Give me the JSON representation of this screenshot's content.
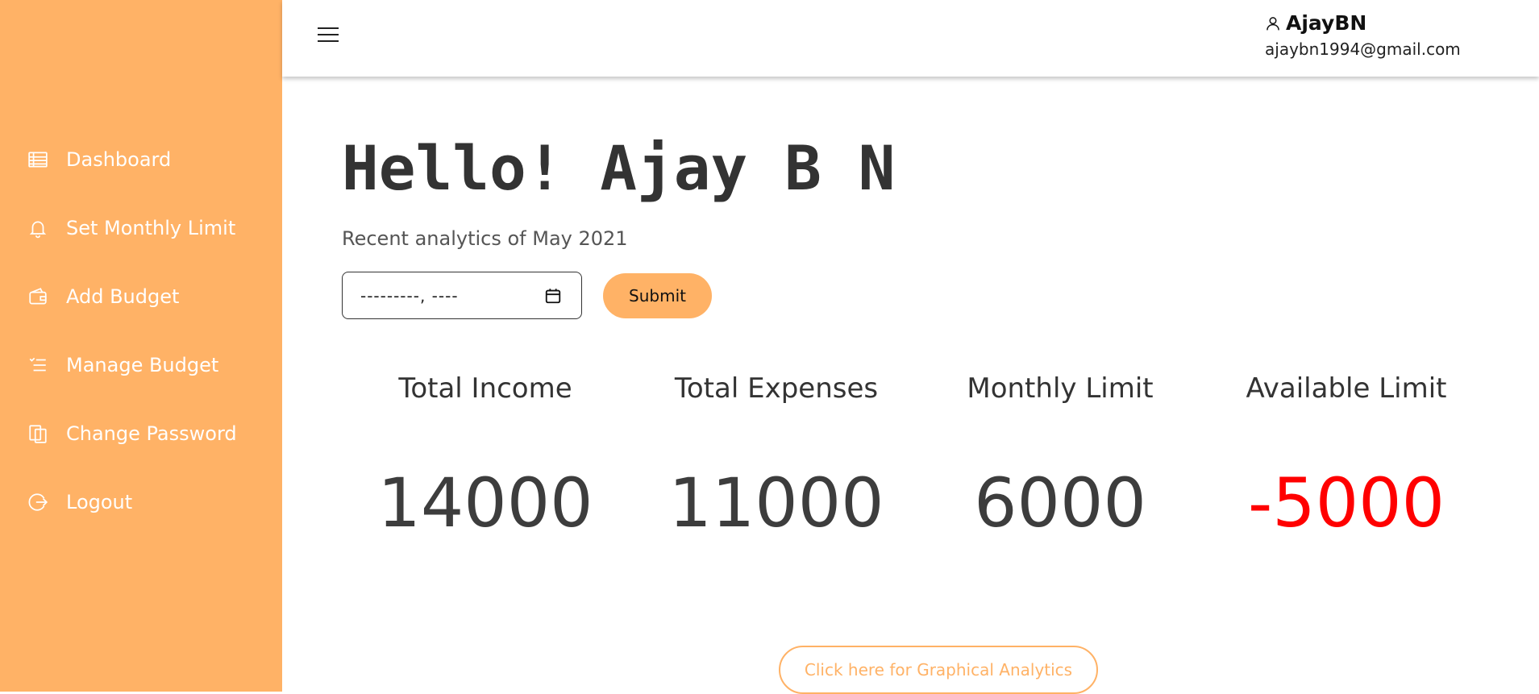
{
  "sidebar": {
    "items": [
      {
        "label": "Dashboard",
        "icon": "dashboard-icon"
      },
      {
        "label": "Set Monthly Limit",
        "icon": "bell-icon"
      },
      {
        "label": "Add Budget",
        "icon": "wallet-icon"
      },
      {
        "label": "Manage Budget",
        "icon": "list-check-icon"
      },
      {
        "label": "Change Password",
        "icon": "copy-icon"
      },
      {
        "label": "Logout",
        "icon": "logout-icon"
      }
    ]
  },
  "header": {
    "user_name": "AjayBN",
    "user_email": "ajaybn1994@gmail.com"
  },
  "main": {
    "greeting": "Hello! Ajay B N",
    "subtitle": "Recent analytics of May 2021",
    "month_input_value": "---------, ----",
    "submit_label": "Submit",
    "stats": [
      {
        "label": "Total Income",
        "value": "14000"
      },
      {
        "label": "Total Expenses",
        "value": "11000"
      },
      {
        "label": "Monthly Limit",
        "value": "6000"
      },
      {
        "label": "Available Limit",
        "value": "-5000",
        "color": "#ff0000"
      }
    ],
    "graph_button_label": "Click here for Graphical Analytics"
  },
  "colors": {
    "accent": "#ffb266",
    "negative": "#ff0000"
  }
}
